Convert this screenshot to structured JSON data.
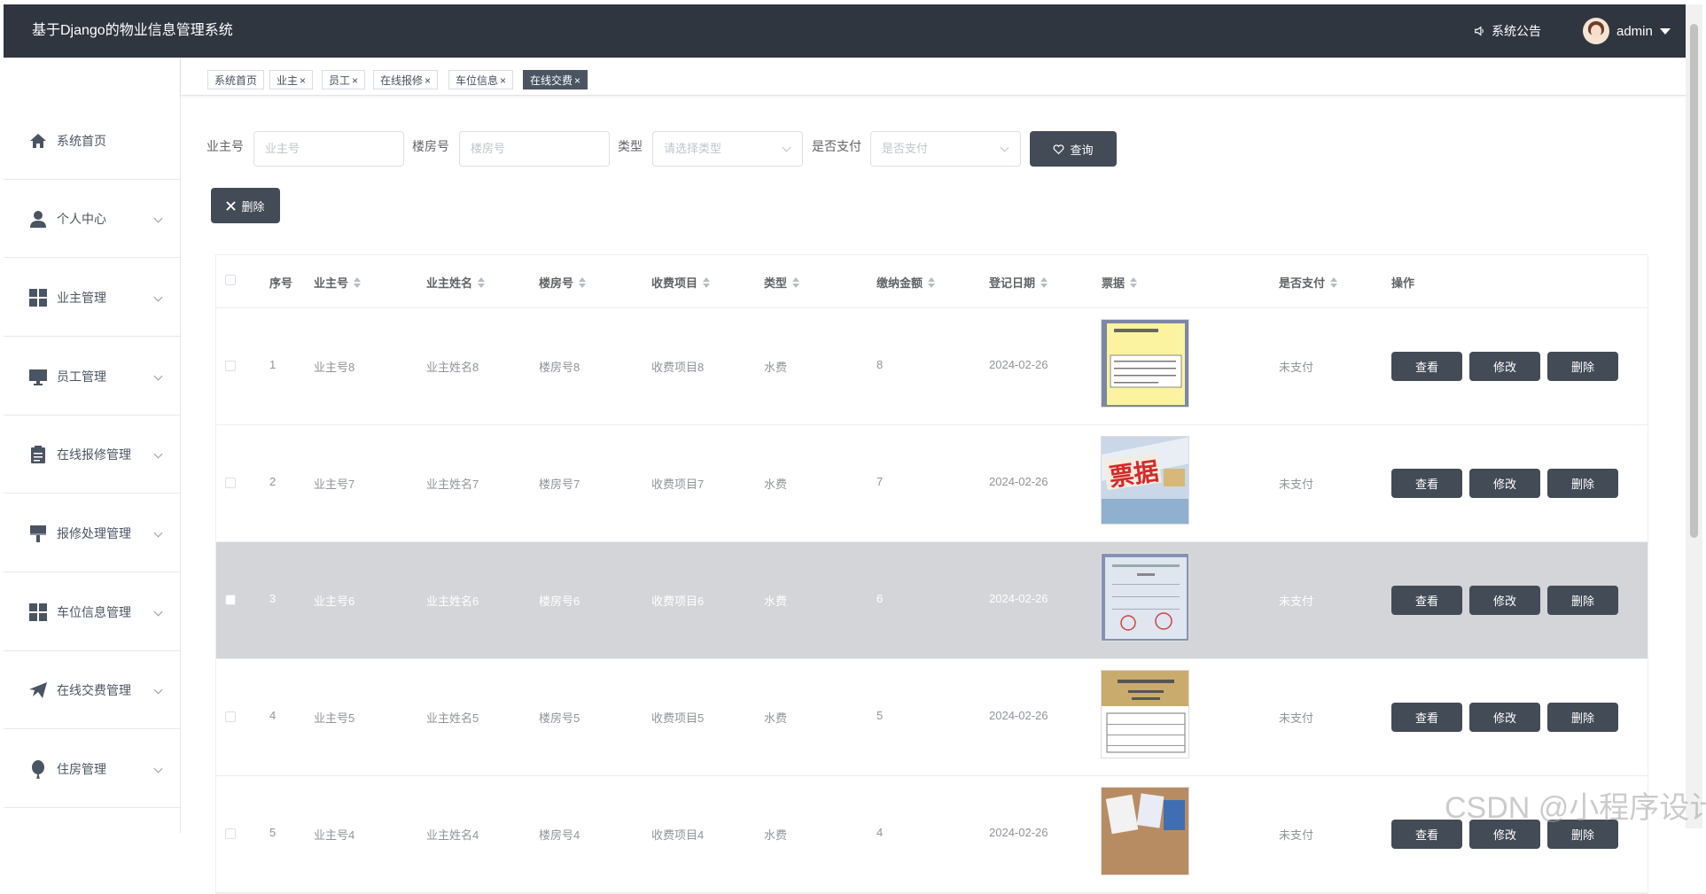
{
  "app": {
    "title": "基于Django的物业信息管理系统"
  },
  "header": {
    "notice_label": "系统公告",
    "username": "admin"
  },
  "sidebar": {
    "items": [
      {
        "label": "系统首页",
        "icon": "home-icon"
      },
      {
        "label": "个人中心",
        "icon": "person-icon"
      },
      {
        "label": "业主管理",
        "icon": "grid-icon"
      },
      {
        "label": "员工管理",
        "icon": "monitor-icon"
      },
      {
        "label": "在线报修管理",
        "icon": "clipboard-icon"
      },
      {
        "label": "报修处理管理",
        "icon": "brush-icon"
      },
      {
        "label": "车位信息管理",
        "icon": "grid-icon"
      },
      {
        "label": "在线交费管理",
        "icon": "paper-plane-icon"
      },
      {
        "label": "住房管理",
        "icon": "balloon-icon"
      }
    ]
  },
  "tabs": [
    {
      "label": "系统首页",
      "closable": false,
      "active": false
    },
    {
      "label": "业主",
      "closable": true,
      "active": false
    },
    {
      "label": "员工",
      "closable": true,
      "active": false
    },
    {
      "label": "在线报修",
      "closable": true,
      "active": false
    },
    {
      "label": "车位信息",
      "closable": true,
      "active": false
    },
    {
      "label": "在线交费",
      "closable": true,
      "active": true
    }
  ],
  "close_symbol": "×",
  "search": {
    "owner_no": {
      "label": "业主号",
      "placeholder": "业主号"
    },
    "building_no": {
      "label": "楼房号",
      "placeholder": "楼房号"
    },
    "type": {
      "label": "类型",
      "placeholder": "请选择类型"
    },
    "paid": {
      "label": "是否支付",
      "placeholder": "是否支付"
    },
    "query_button": "查询"
  },
  "delete_button": "删除",
  "table": {
    "headers": [
      "序号",
      "业主号",
      "业主姓名",
      "楼房号",
      "收费项目",
      "类型",
      "缴纳金额",
      "登记日期",
      "票据",
      "是否支付",
      "操作"
    ],
    "actions": {
      "view": "查看",
      "edit": "修改",
      "delete": "删除"
    },
    "rows": [
      {
        "index": "1",
        "owner_no": "业主号8",
        "owner_name": "业主姓名8",
        "building_no": "楼房号8",
        "fee_item": "收费项目8",
        "type": "水费",
        "amount": "8",
        "date": "2024-02-26",
        "paid": "未支付"
      },
      {
        "index": "2",
        "owner_no": "业主号7",
        "owner_name": "业主姓名7",
        "building_no": "楼房号7",
        "fee_item": "收费项目7",
        "type": "水费",
        "amount": "7",
        "date": "2024-02-26",
        "paid": "未支付",
        "receipt_text": "票据"
      },
      {
        "index": "3",
        "owner_no": "业主号6",
        "owner_name": "业主姓名6",
        "building_no": "楼房号6",
        "fee_item": "收费项目6",
        "type": "水费",
        "amount": "6",
        "date": "2024-02-26",
        "paid": "未支付"
      },
      {
        "index": "4",
        "owner_no": "业主号5",
        "owner_name": "业主姓名5",
        "building_no": "楼房号5",
        "fee_item": "收费项目5",
        "type": "水费",
        "amount": "5",
        "date": "2024-02-26",
        "paid": "未支付"
      },
      {
        "index": "5",
        "owner_no": "业主号4",
        "owner_name": "业主姓名4",
        "building_no": "楼房号4",
        "fee_item": "收费项目4",
        "type": "水费",
        "amount": "4",
        "date": "2024-02-26",
        "paid": "未支付"
      }
    ]
  },
  "watermark": "CSDN @小程序设计",
  "colors": {
    "topbar": "#2f3640",
    "button": "#424b56",
    "highlight_row": "#d3d5d8"
  }
}
